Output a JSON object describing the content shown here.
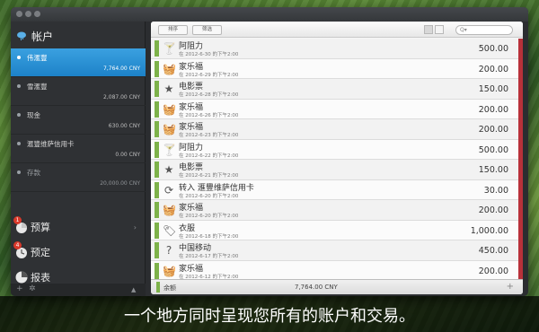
{
  "sidebar": {
    "title": "帐户",
    "accounts": [
      {
        "name": "伟滙豐",
        "balance": "7,764.00 CNY"
      },
      {
        "name": "雪滙豐",
        "balance": "2,087.00 CNY"
      },
      {
        "name": "现金",
        "balance": "630.00 CNY"
      },
      {
        "name": "滙豐维萨信用卡",
        "balance": "0.00 CNY"
      },
      {
        "name": "存款",
        "balance": "20,000.00 CNY"
      }
    ],
    "nav": [
      {
        "label": "预算",
        "badge": "1"
      },
      {
        "label": "预定",
        "badge": "4"
      },
      {
        "label": "报表"
      }
    ]
  },
  "toolbar": {
    "sort_label": "排序",
    "filter_label": "筛选",
    "search_placeholder": "Q▾"
  },
  "transactions": [
    {
      "payee": "阿阻力",
      "date": "在 2012-6-30 的下午2:00",
      "amount": "500.00",
      "icon": "cocktail-icon"
    },
    {
      "payee": "家乐福",
      "date": "在 2012-6-29 的下午2:00",
      "amount": "200.00",
      "icon": "basket-icon"
    },
    {
      "payee": "电影票",
      "date": "在 2012-6-28 的下午2:00",
      "amount": "150.00",
      "icon": "star-icon"
    },
    {
      "payee": "家乐福",
      "date": "在 2012-6-26 的下午2:00",
      "amount": "200.00",
      "icon": "basket-icon"
    },
    {
      "payee": "家乐福",
      "date": "在 2012-6-23 的下午2:00",
      "amount": "200.00",
      "icon": "basket-icon"
    },
    {
      "payee": "阿阻力",
      "date": "在 2012-6-22 的下午2:00",
      "amount": "500.00",
      "icon": "cocktail-icon"
    },
    {
      "payee": "电影票",
      "date": "在 2012-6-21 的下午2:00",
      "amount": "150.00",
      "icon": "star-icon"
    },
    {
      "payee": "转入 滙豐维萨信用卡",
      "date": "在 2012-6-20 的下午2:00",
      "amount": "30.00",
      "icon": "transfer-icon"
    },
    {
      "payee": "家乐福",
      "date": "在 2012-6-20 的下午2:00",
      "amount": "200.00",
      "icon": "basket-icon"
    },
    {
      "payee": "衣服",
      "date": "在 2012-6-18 的下午2:00",
      "amount": "1,000.00",
      "icon": "tag-icon"
    },
    {
      "payee": "中国移动",
      "date": "在 2012-6-17 的下午2:00",
      "amount": "450.00",
      "icon": "question-icon"
    },
    {
      "payee": "家乐福",
      "date": "在 2012-6-12 的下午2:00",
      "amount": "200.00",
      "icon": "basket-icon"
    }
  ],
  "footer": {
    "balance_label": "余额",
    "balance_total": "7,764.00 CNY"
  },
  "caption": "一个地方同时呈现您所有的账户和交易。"
}
